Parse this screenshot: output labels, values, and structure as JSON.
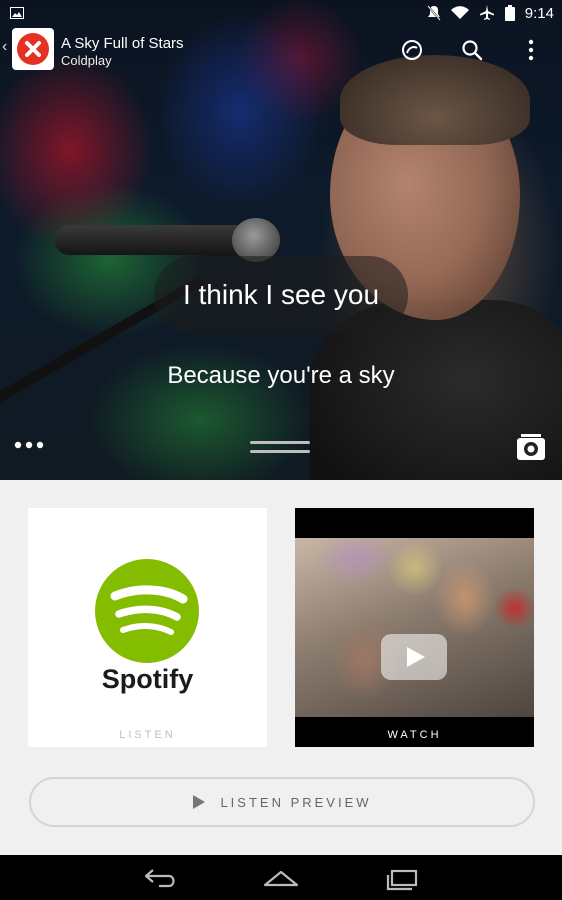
{
  "status_bar": {
    "time": "9:14",
    "icons": [
      "image-icon",
      "mute-icon",
      "wifi-icon",
      "airplane-icon",
      "battery-icon"
    ]
  },
  "now_playing": {
    "title": "A Sky Full of Stars",
    "artist": "Coldplay"
  },
  "toolbar": {
    "icons": [
      "lyrics-sync-icon",
      "search-icon",
      "more-vert-icon"
    ]
  },
  "lyrics": {
    "current_line": "I think I see you",
    "next_line": "Because you're a sky"
  },
  "cards": {
    "listen": {
      "brand": "Spotify",
      "label": "LISTEN"
    },
    "watch": {
      "label": "WATCH"
    }
  },
  "preview_button": {
    "label": "LISTEN PREVIEW"
  },
  "colors": {
    "app_badge_red": "#e53124",
    "spotify_green": "#84bd00",
    "panel_bg": "#f0f0f0"
  },
  "nav_bar": {
    "icons": [
      "back-icon",
      "home-icon",
      "recents-icon"
    ]
  }
}
